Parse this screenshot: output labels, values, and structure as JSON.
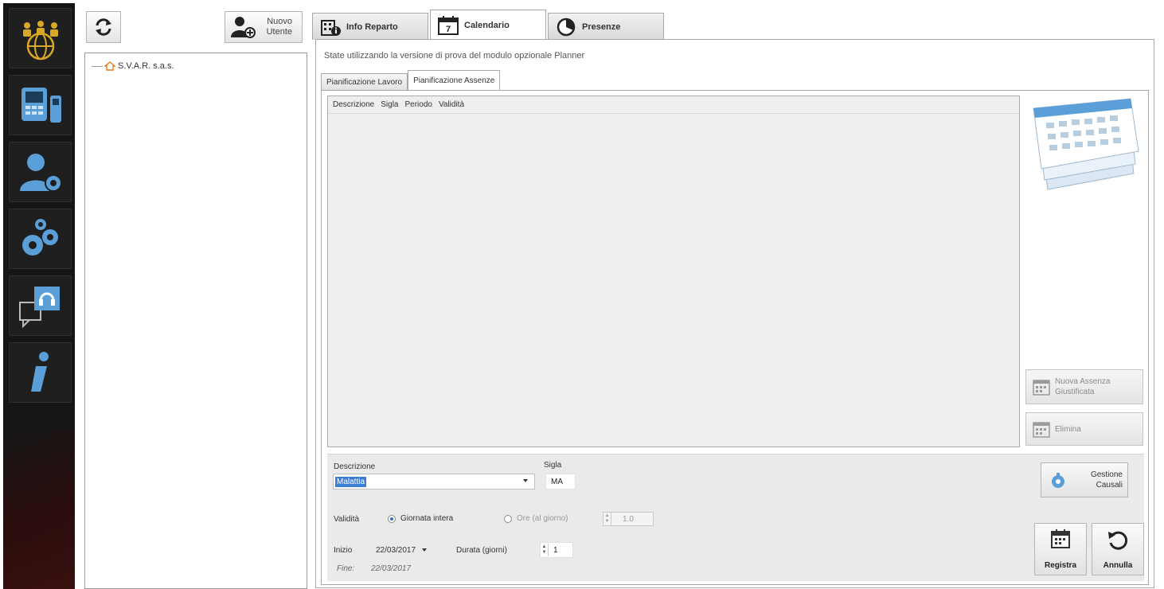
{
  "sidebar": {
    "buttons": [
      {
        "name": "people-globe"
      },
      {
        "name": "terminal-device"
      },
      {
        "name": "user-key"
      },
      {
        "name": "gears"
      },
      {
        "name": "support"
      },
      {
        "name": "info"
      }
    ]
  },
  "tree_panel": {
    "new_user_label_1": "Nuovo",
    "new_user_label_2": "Utente",
    "root_label": "S.V.A.R. s.a.s."
  },
  "main_tabs": [
    {
      "label": "Info Reparto"
    },
    {
      "label": "Calendario"
    },
    {
      "label": "Presenze"
    }
  ],
  "main": {
    "trial_message": "State utilizzando la versione di prova del modulo opzionale Planner",
    "sub_tabs": [
      {
        "label": "Pianificazione Lavoro"
      },
      {
        "label": "Pianificazione Assenze"
      }
    ],
    "grid_columns": [
      "Descrizione",
      "Sigla",
      "Periodo",
      "Validità"
    ],
    "new_absence_label_1": "Nuova Assenza",
    "new_absence_label_2": "Giustificata",
    "delete_label": "Elimina"
  },
  "editor": {
    "description_label": "Descrizione",
    "description_value": "Malattia",
    "sigla_label": "Sigla",
    "sigla_value": "MA",
    "validity_label": "Validità",
    "full_day_label": "Giornata intera",
    "hours_label": "Ore (al giorno)",
    "hours_value": "1.0",
    "start_label": "Inizio",
    "start_value": "22/03/2017",
    "duration_label": "Durata (giorni)",
    "duration_value": "1",
    "end_label": "Fine:",
    "end_value": "22/03/2017",
    "manage_label_1": "Gestione",
    "manage_label_2": "Causali",
    "save_label": "Registra",
    "cancel_label": "Annulla"
  },
  "colors": {
    "accent": "#3b7ed3",
    "sidebar_bg": "#151515",
    "icon_blue": "#5a9fd8",
    "icon_gold": "#d9a826"
  }
}
